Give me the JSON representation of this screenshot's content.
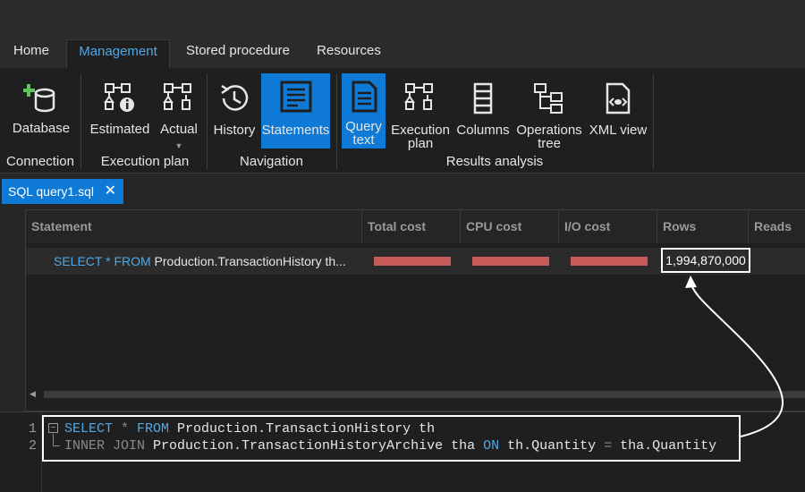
{
  "menu": {
    "tabs": [
      {
        "label": "Home"
      },
      {
        "label": "Management"
      },
      {
        "label": "Stored procedure"
      },
      {
        "label": "Resources"
      }
    ],
    "active_index": 1
  },
  "ribbon": {
    "groups": {
      "connection": "Connection",
      "execution_plan": "Execution plan",
      "navigation": "Navigation",
      "results_analysis": "Results analysis"
    },
    "buttons": {
      "database": "Database",
      "estimated": "Estimated",
      "actual": "Actual",
      "history": "History",
      "statements": "Statements",
      "query_text_1": "Query",
      "query_text_2": "text",
      "execution_plan_1": "Execution",
      "execution_plan_2": "plan",
      "columns": "Columns",
      "operations_tree_1": "Operations",
      "operations_tree_2": "tree",
      "xml_view": "XML view"
    },
    "selected": [
      "Statements",
      "Query text"
    ]
  },
  "document_tab": {
    "label": "SQL query1.sql",
    "close_glyph": "✕"
  },
  "grid": {
    "columns": [
      "Statement",
      "Total cost",
      "CPU cost",
      "I/O cost",
      "Rows",
      "Reads"
    ],
    "row": {
      "statement_kw1": "SELECT",
      "statement_star": " * ",
      "statement_kw2": "FROM",
      "statement_rest": " Production.TransactionHistory th...",
      "rows": "1,994,870,000",
      "bar_color": "#c85a5a"
    },
    "scroll_left_glyph": "◀"
  },
  "editor": {
    "line_numbers": [
      "1",
      "2"
    ],
    "fold_glyph": "−",
    "line1": {
      "kw1": "SELECT",
      "star": " * ",
      "kw2": "FROM",
      "rest": " Production.TransactionHistory th"
    },
    "line2": {
      "kw1": "INNER JOIN",
      "mid": " Production.TransactionHistoryArchive tha ",
      "kw2": "ON",
      "rest1": " th.Quantity ",
      "eq": "=",
      "rest2": " tha.Quantity"
    }
  },
  "colors": {
    "accent": "#0e7ad6",
    "keyword": "#4fa8e6",
    "bar": "#c85a5a",
    "highlight_box": "#ffffff"
  }
}
